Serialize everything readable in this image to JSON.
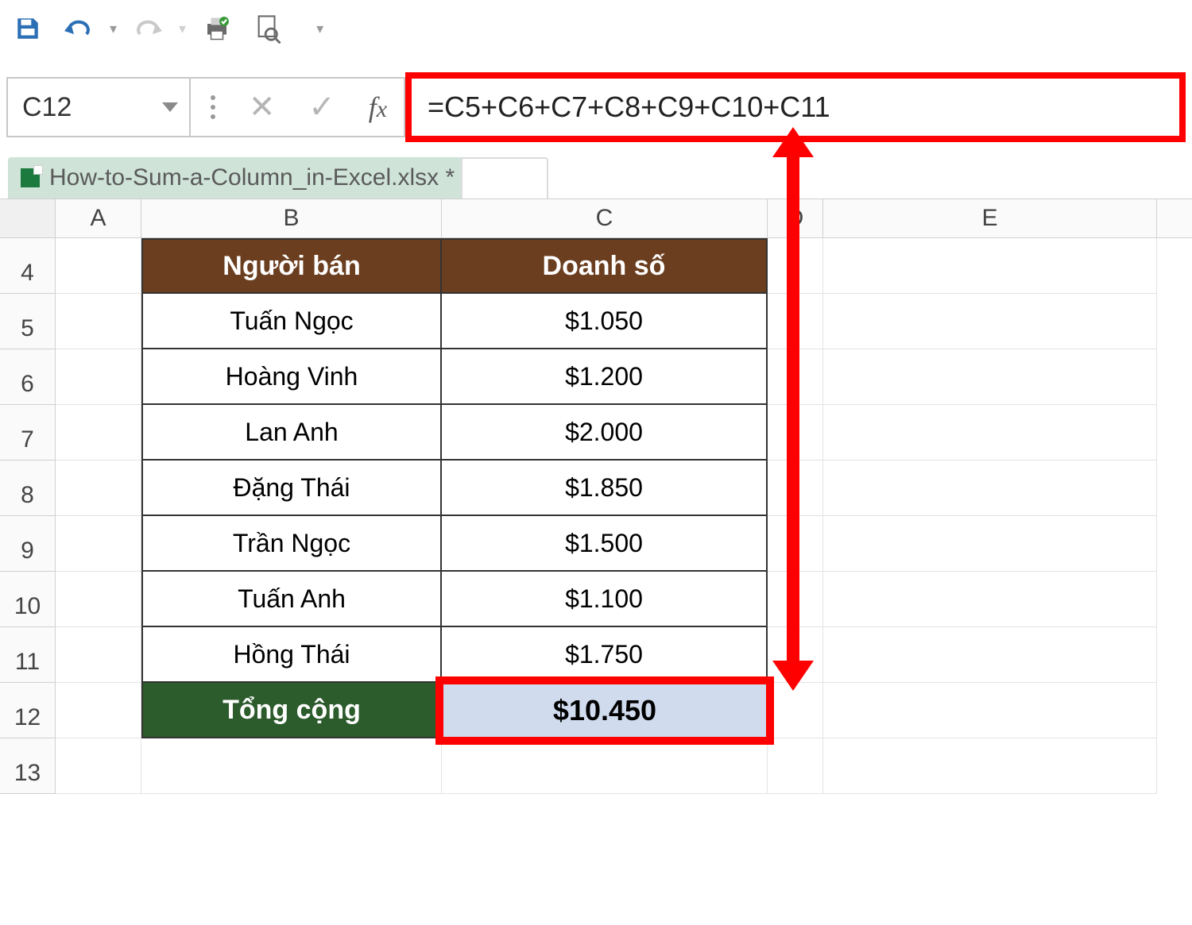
{
  "qat": {
    "save": "save-icon",
    "undo": "undo-icon",
    "redo": "redo-icon",
    "printprev": "quick-print-icon",
    "preview": "print-preview-icon"
  },
  "namebox": {
    "value": "C12"
  },
  "formula_bar": {
    "formula": "=C5+C6+C7+C8+C9+C10+C11"
  },
  "workbook_tab": {
    "name": "How-to-Sum-a-Column_in-Excel.xlsx *"
  },
  "columns": {
    "A": "A",
    "B": "B",
    "C": "C",
    "D": "D",
    "E": "E"
  },
  "rows": [
    "4",
    "5",
    "6",
    "7",
    "8",
    "9",
    "10",
    "11",
    "12",
    "13"
  ],
  "table": {
    "header": {
      "B": "Người bán",
      "C": "Doanh số"
    },
    "data": [
      {
        "B": "Tuấn Ngọc",
        "C": "$1.050"
      },
      {
        "B": "Hoàng Vinh",
        "C": "$1.200"
      },
      {
        "B": "Lan Anh",
        "C": "$2.000"
      },
      {
        "B": "Đặng Thái",
        "C": "$1.850"
      },
      {
        "B": "Trần Ngọc",
        "C": "$1.500"
      },
      {
        "B": "Tuấn Anh",
        "C": "$1.100"
      },
      {
        "B": "Hồng Thái",
        "C": "$1.750"
      }
    ],
    "total": {
      "B": "Tổng cộng",
      "C": "$10.450"
    }
  }
}
